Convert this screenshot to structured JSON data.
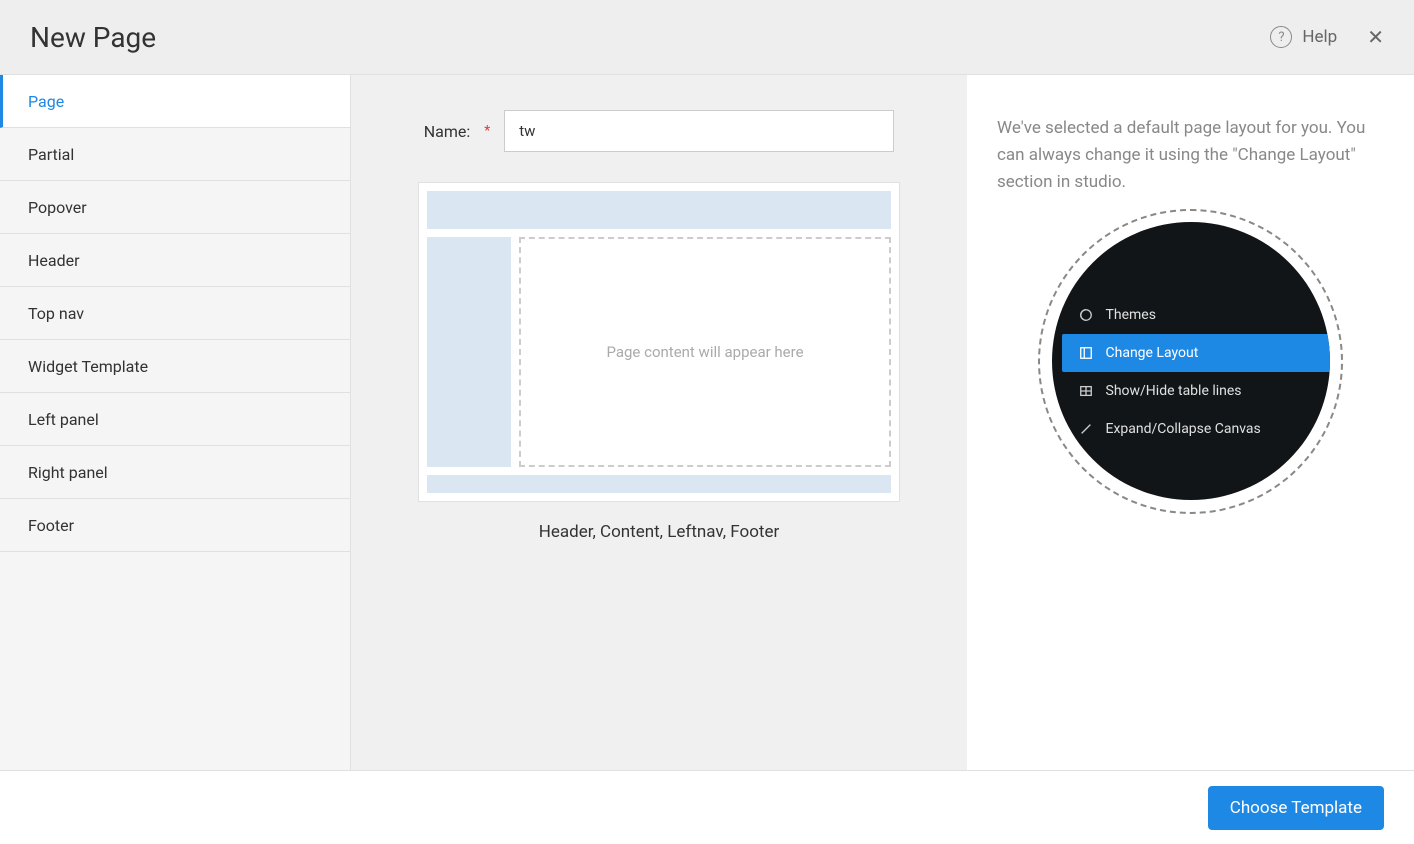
{
  "header": {
    "title": "New Page",
    "help_label": "Help"
  },
  "sidebar": {
    "items": [
      {
        "label": "Page",
        "active": true
      },
      {
        "label": "Partial",
        "active": false
      },
      {
        "label": "Popover",
        "active": false
      },
      {
        "label": "Header",
        "active": false
      },
      {
        "label": "Top nav",
        "active": false
      },
      {
        "label": "Widget Template",
        "active": false
      },
      {
        "label": "Left panel",
        "active": false
      },
      {
        "label": "Right panel",
        "active": false
      },
      {
        "label": "Footer",
        "active": false
      }
    ]
  },
  "form": {
    "name_label": "Name:",
    "name_value": "tw"
  },
  "preview": {
    "placeholder": "Page content will appear here",
    "caption": "Header, Content, Leftnav, Footer"
  },
  "right_panel": {
    "description": "We've selected a default page layout for you. You can always change it using the \"Change Layout\" section in studio.",
    "menu_items": [
      {
        "label": "Themes",
        "highlighted": false
      },
      {
        "label": "Change Layout",
        "highlighted": true
      },
      {
        "label": "Show/Hide table lines",
        "highlighted": false
      },
      {
        "label": "Expand/Collapse Canvas",
        "highlighted": false
      }
    ]
  },
  "footer": {
    "choose_template_label": "Choose Template"
  }
}
